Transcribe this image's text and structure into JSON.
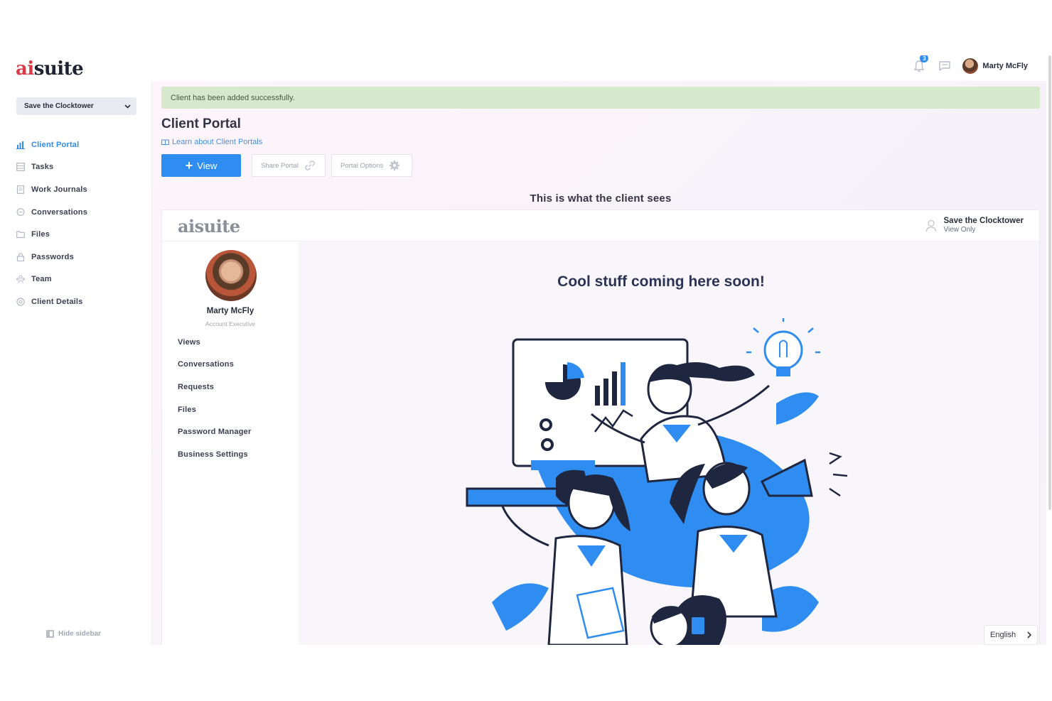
{
  "app": {
    "logo_ai": "ai",
    "logo_rest": "suite"
  },
  "topbar": {
    "notification_count": "3",
    "user_name": "Marty McFly"
  },
  "sidebar": {
    "project": "Save the Clocktower",
    "items": [
      {
        "label": "Client Portal",
        "icon": "chart-icon",
        "active": true
      },
      {
        "label": "Tasks",
        "icon": "tasks-icon",
        "active": false
      },
      {
        "label": "Work Journals",
        "icon": "journal-icon",
        "active": false
      },
      {
        "label": "Conversations",
        "icon": "chat-icon",
        "active": false
      },
      {
        "label": "Files",
        "icon": "folder-icon",
        "active": false
      },
      {
        "label": "Passwords",
        "icon": "lock-icon",
        "active": false
      },
      {
        "label": "Team",
        "icon": "team-icon",
        "active": false
      },
      {
        "label": "Client Details",
        "icon": "details-icon",
        "active": false
      }
    ],
    "hide_label": "Hide sidebar"
  },
  "main": {
    "alert": "Client has been added successfully.",
    "title": "Client Portal",
    "learn_link": "Learn about Client Portals",
    "view_button": "View",
    "share_button": "Share Portal",
    "options_button": "Portal Options",
    "preview_caption": "This is what the client sees"
  },
  "preview": {
    "logo_ai": "ai",
    "logo_rest": "suite",
    "project_name": "Save the Clocktower",
    "access": "View Only",
    "contact_name": "Marty McFly",
    "contact_role": "Account Executive",
    "nav": [
      "Views",
      "Conversations",
      "Requests",
      "Files",
      "Password Manager",
      "Business Settings"
    ],
    "heading": "Cool stuff coming here soon!"
  },
  "footer": {
    "language": "English"
  },
  "colors": {
    "accent": "#2f8cf0",
    "brand_red": "#d93a4a",
    "alert_bg": "#d6e9cc",
    "navy": "#2b3454"
  }
}
